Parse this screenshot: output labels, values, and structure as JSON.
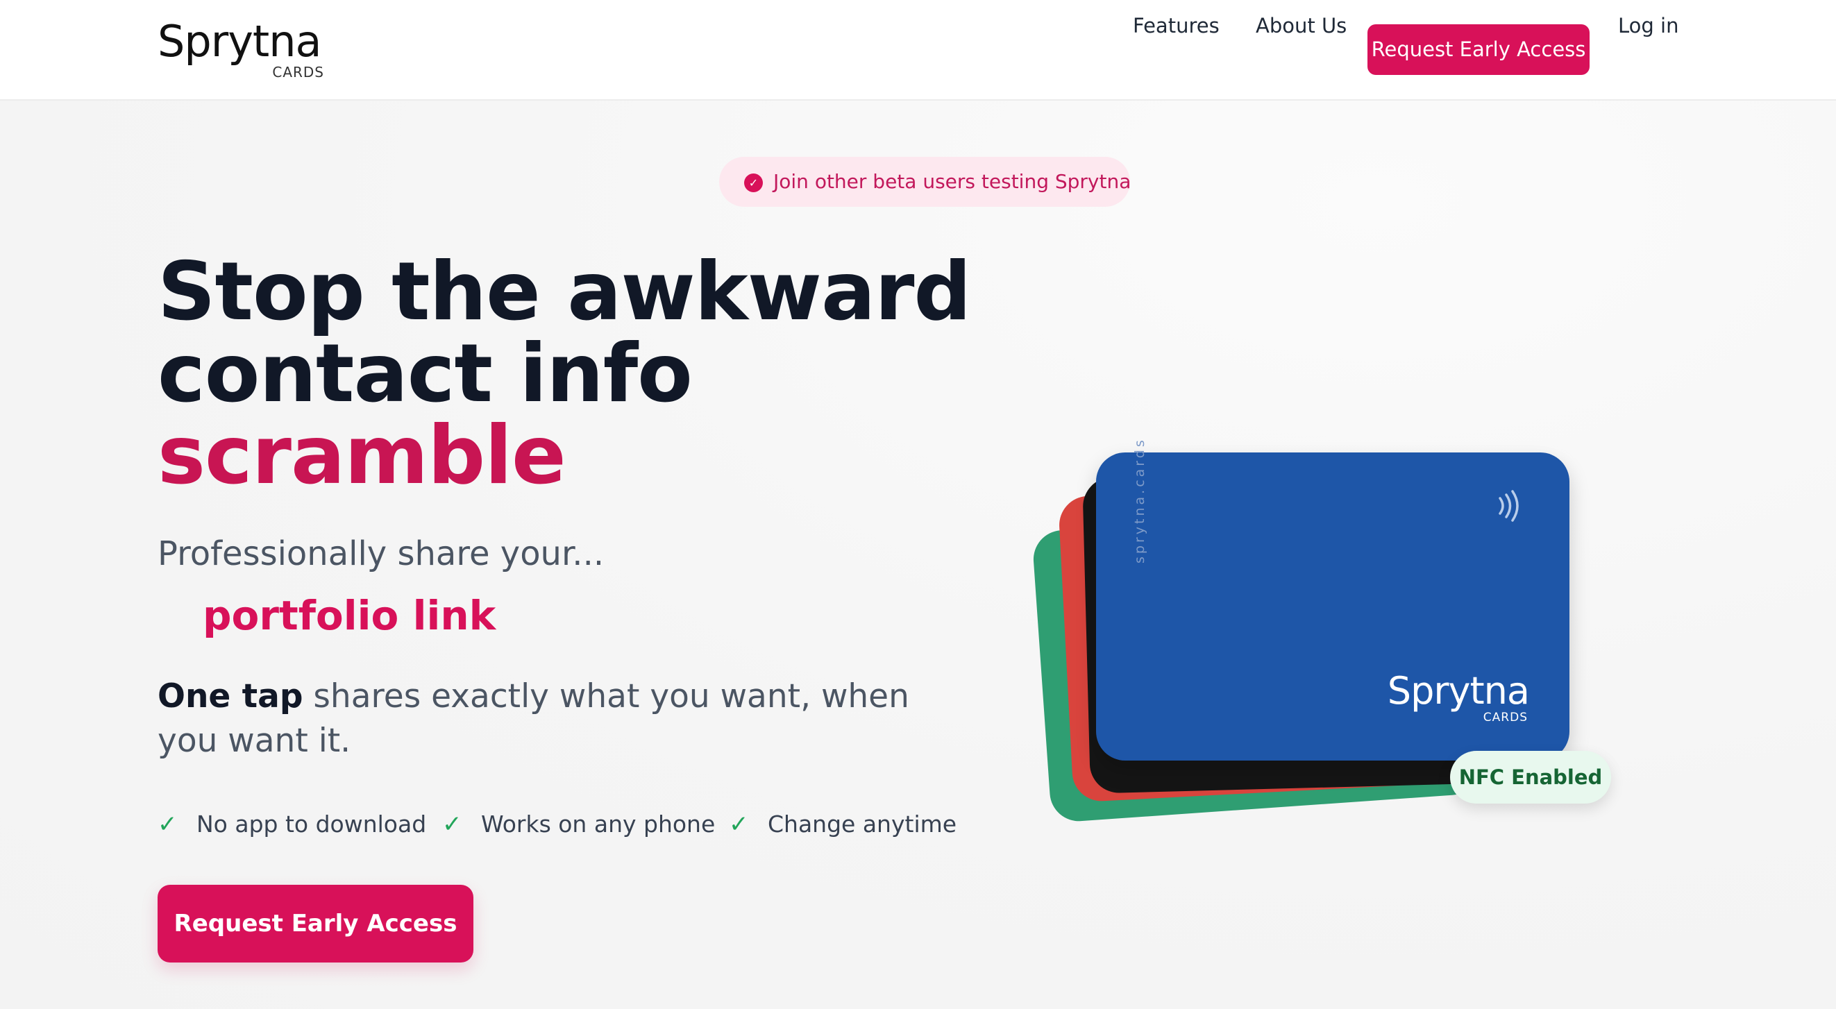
{
  "brand": {
    "name": "Sprytna",
    "sub": "CARDS"
  },
  "nav": {
    "features": "Features",
    "about": "About Us",
    "cta": "Request Early Access",
    "login": "Log in"
  },
  "beta_pill": {
    "icon": "check-circle-icon",
    "text": "Join other beta users testing Sprytna"
  },
  "hero": {
    "headline_line1": "Stop the awkward",
    "headline_line2": "contact info",
    "headline_accent": "scramble",
    "lead": "Professionally share your...",
    "rotating_word": "portfolio link",
    "tagline_bold": "One tap",
    "tagline_rest": " shares exactly what you want, when you want it.",
    "checks": [
      {
        "icon": "check-icon",
        "label": "No app to download"
      },
      {
        "icon": "check-icon",
        "label": "Works on any phone"
      },
      {
        "icon": "check-icon",
        "label": "Change anytime"
      }
    ],
    "cta": "Request Early Access"
  },
  "card": {
    "side_text": "sprytna.cards",
    "logo_word": "Sprytna",
    "logo_sub": "CARDS",
    "nfc_icon": "nfc-waves-icon",
    "badge": "NFC Enabled"
  },
  "colors": {
    "accent": "#d81159",
    "card_blue": "#1e56a8",
    "card_black": "#151515",
    "card_red": "#d9443d",
    "card_green": "#2f9e72",
    "check_green": "#22a55a"
  }
}
